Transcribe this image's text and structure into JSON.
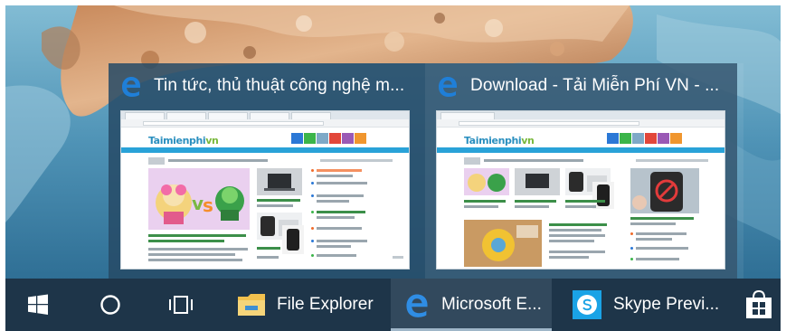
{
  "taskbar": {
    "start_icon": "windows-logo-icon",
    "search_icon": "cortana-circle-icon",
    "task_view_icon": "task-view-icon",
    "apps": [
      {
        "label": "File Explorer",
        "icon": "folder-icon"
      },
      {
        "label": "Microsoft E...",
        "icon": "edge-icon"
      },
      {
        "label": "Skype Previ...",
        "icon": "skype-icon"
      }
    ],
    "store_icon": "store-bag-icon"
  },
  "flyout": {
    "windows": [
      {
        "title": "Tin tức, thủ thuật công nghệ m...",
        "icon": "edge-icon"
      },
      {
        "title": "Download - Tải Miễn Phí VN - ...",
        "icon": "edge-icon"
      }
    ]
  },
  "thumbnail": {
    "site_logo": "Taimienphi",
    "site_logo_suffix": "vn"
  },
  "colors": {
    "taskbar": "#1e3549",
    "taskbar_active": "#32495d",
    "flyout": "#264a66",
    "edge_blue": "#1f7fd8",
    "skype_blue": "#1aa3e6",
    "folder_yellow": "#f2c14e",
    "site_accent": "#29a2d8"
  }
}
